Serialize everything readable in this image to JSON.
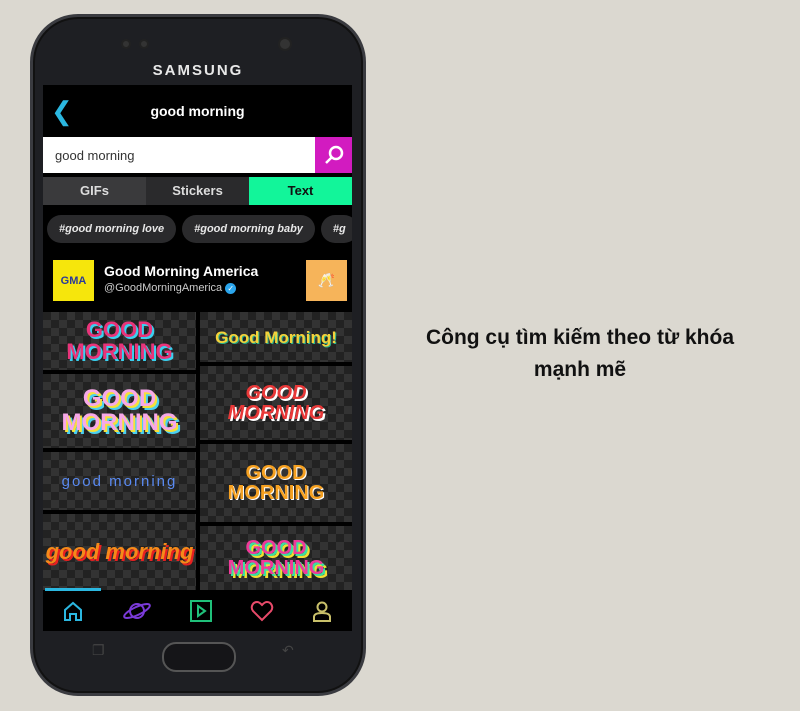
{
  "device": {
    "brand": "SAMSUNG"
  },
  "header": {
    "title": "good morning"
  },
  "search": {
    "value": "good morning"
  },
  "tabs": [
    {
      "label": "GIFs"
    },
    {
      "label": "Stickers"
    },
    {
      "label": "Text",
      "active": true
    }
  ],
  "tags": [
    "#good morning love",
    "#good morning baby",
    "#g"
  ],
  "channel": {
    "name": "Good Morning America",
    "handle": "@GoodMorningAmerica",
    "logo": "GMA",
    "verified": true
  },
  "results": [
    "GOOD MORNING",
    "Good Morning!",
    "GOOD MORNING",
    "GOOD MORNING",
    "good morning",
    "GOOD MORNING",
    "good morning",
    "GOOD MORNING"
  ],
  "nav": [
    "home-icon",
    "explore-planet-icon",
    "video-play-icon",
    "favorites-heart-icon",
    "profile-icon"
  ],
  "colors": {
    "accent_search": "#d21bc0",
    "accent_tab": "#12f59a",
    "back": "#2bb7e0"
  },
  "caption": {
    "line1": "Công cụ tìm kiếm theo từ khóa",
    "line2": "mạnh mẽ"
  }
}
